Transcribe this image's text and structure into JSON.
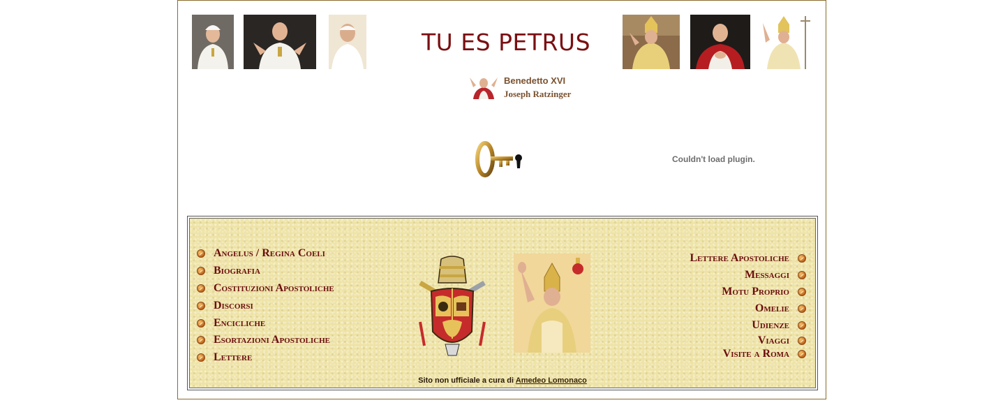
{
  "header": {
    "title": "TU ES PETRUS",
    "name_primary": "Benedetto XVI",
    "name_secondary": "Joseph Ratzinger"
  },
  "photos": [
    {
      "name": "pope-photo-1",
      "icon": "pope-portrait"
    },
    {
      "name": "pope-photo-2",
      "icon": "pope-portrait"
    },
    {
      "name": "pope-photo-3",
      "icon": "pope-portrait"
    },
    {
      "name": "pope-photo-4",
      "icon": "pope-portrait"
    },
    {
      "name": "pope-photo-5",
      "icon": "pope-portrait"
    },
    {
      "name": "pope-photo-6",
      "icon": "pope-portrait"
    }
  ],
  "plugin": {
    "message": "Couldn't load plugin."
  },
  "menu": {
    "left": [
      "Angelus / Regina Coeli",
      "Biografia",
      "Costituzioni Apostoliche",
      "Discorsi",
      "Encicliche",
      "Esortazioni Apostoliche",
      "Lettere"
    ],
    "right": [
      "Lettere Apostoliche",
      "Messaggi",
      "Motu Proprio",
      "Omelie",
      "Udienze",
      "Viaggi",
      "Visite a Roma"
    ]
  },
  "footer": {
    "text": "Sito non ufficiale a cura di",
    "author": "Amedeo Lomonaco"
  },
  "colors": {
    "title": "#7a0f12",
    "link": "#6b0d0d",
    "menu_bg": "#eee3a6",
    "frame": "#8b6a2b"
  }
}
